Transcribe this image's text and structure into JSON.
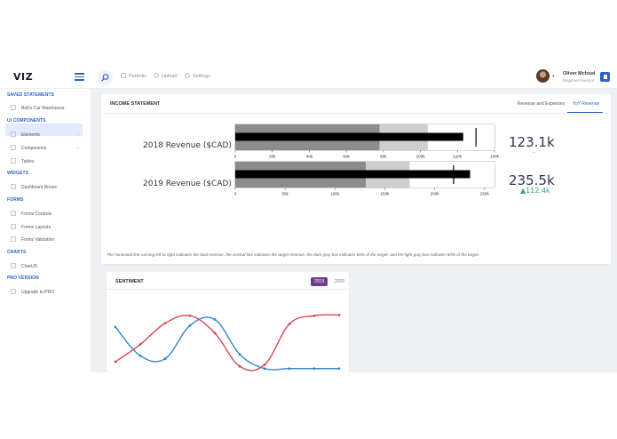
{
  "topbar": {
    "logo": "VIZ",
    "nav": [
      {
        "label": "Portfolio"
      },
      {
        "label": "Upload"
      },
      {
        "label": "Settings"
      }
    ],
    "user": {
      "name": "Oliver Mcloud",
      "role": "Beginner Investor"
    }
  },
  "sidebar": {
    "saved_heading": "SAVED STATEMENTS",
    "saved_item": "Bob's Car Warehouse",
    "ui_heading": "UI COMPONENTS",
    "ui_items": [
      "Elements",
      "Components",
      "Tables"
    ],
    "widgets_heading": "WIDGETS",
    "widgets_items": [
      "Dashboard Boxes"
    ],
    "forms_heading": "FORMS",
    "forms_items": [
      "Forms Controls",
      "Forms Layouts",
      "Forms Validation"
    ],
    "charts_heading": "CHARTS",
    "charts_items": [
      "ChartJS"
    ],
    "pro_heading": "PRO VERSION",
    "pro_items": [
      "Upgrade to PRO"
    ]
  },
  "income": {
    "title": "INCOME STATEMENT",
    "tabs": [
      "Revenue and Expenses",
      "YoY Revenue"
    ],
    "active_tab": "YoY Revenue",
    "footnote": "The horizontal line running left to right indicates the total revenue, the vertical line indicates the target revenue, the dark gray box indicates 60% of the target, and the light gray box indicates 80% of the target.",
    "rows": [
      {
        "label": "2018 Revenue ($CAD)",
        "value_text": "123.1k",
        "delta_text": "-"
      },
      {
        "label": "2019 Revenue ($CAD)",
        "value_text": "235.5k",
        "delta_text": "▲112.4k"
      }
    ]
  },
  "sentiment": {
    "title": "SENTIMENT",
    "years": [
      "2019",
      "2020"
    ],
    "active_year": "2019"
  },
  "colors": {
    "accent": "#2d63c8",
    "purple": "#6a3d8e",
    "fab": "#f4b400",
    "series_red": "#d64550",
    "series_blue": "#2f86d0",
    "positive": "#2aa37a"
  },
  "chart_data": [
    {
      "type": "bullet",
      "label": "2018 Revenue ($CAD)",
      "xlim": [
        0,
        140000
      ],
      "ticks": [
        "0",
        "20k",
        "40k",
        "60k",
        "80k",
        "100k",
        "120k",
        "140k"
      ],
      "tick_values": [
        0,
        20000,
        40000,
        60000,
        80000,
        100000,
        120000,
        140000
      ],
      "ranges": [
        78000,
        104000,
        130000,
        145000
      ],
      "measure": 123100,
      "target": 130000
    },
    {
      "type": "bullet",
      "label": "2019 Revenue ($CAD)",
      "xlim": [
        0,
        260000
      ],
      "ticks": [
        "0",
        "50k",
        "100k",
        "150k",
        "200k",
        "250k"
      ],
      "tick_values": [
        0,
        50000,
        100000,
        150000,
        200000,
        250000
      ],
      "ranges": [
        131000,
        175000,
        219000,
        260000
      ],
      "measure": 235500,
      "target": 219000
    },
    {
      "type": "line",
      "x": [
        0,
        1,
        2,
        3,
        4,
        5,
        6,
        7,
        8,
        9
      ],
      "ylim": [
        0,
        100
      ],
      "series": [
        {
          "color": "#d64550",
          "values": [
            14,
            37,
            65,
            75,
            52,
            8,
            10,
            64,
            75,
            76
          ]
        },
        {
          "color": "#2f86d0",
          "values": [
            60,
            22,
            18,
            62,
            70,
            24,
            5,
            5,
            5,
            5
          ]
        }
      ]
    }
  ]
}
